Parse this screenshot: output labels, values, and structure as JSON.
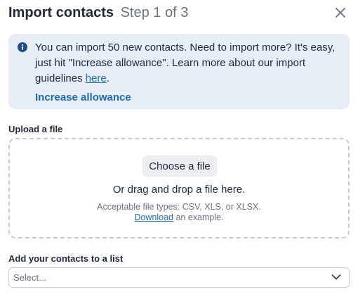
{
  "header": {
    "title": "Import contacts",
    "step": "Step 1 of 3"
  },
  "notice": {
    "text_before_link": "You can import 50 new contacts. Need to import more? It's easy, just hit \"Increase allowance\". Learn more about our import guidelines ",
    "link_text": "here",
    "text_after_link": ".",
    "action_label": "Increase allowance"
  },
  "upload": {
    "label": "Upload a file",
    "button_label": "Choose a file",
    "drag_text": "Or drag and drop a file here.",
    "types_text": "Acceptable file types: CSV, XLS, or XLSX.",
    "download_link": "Download",
    "download_suffix": " an example."
  },
  "list_select": {
    "label": "Add your contacts to a list",
    "placeholder": "Select..."
  },
  "colors": {
    "accent": "#1f6bb5",
    "notice_bg": "#e6edf6",
    "info_icon": "#1f4e8c"
  },
  "icons": {
    "close": "close-icon",
    "info": "info-icon",
    "dropdown": "chevron-down-icon"
  }
}
